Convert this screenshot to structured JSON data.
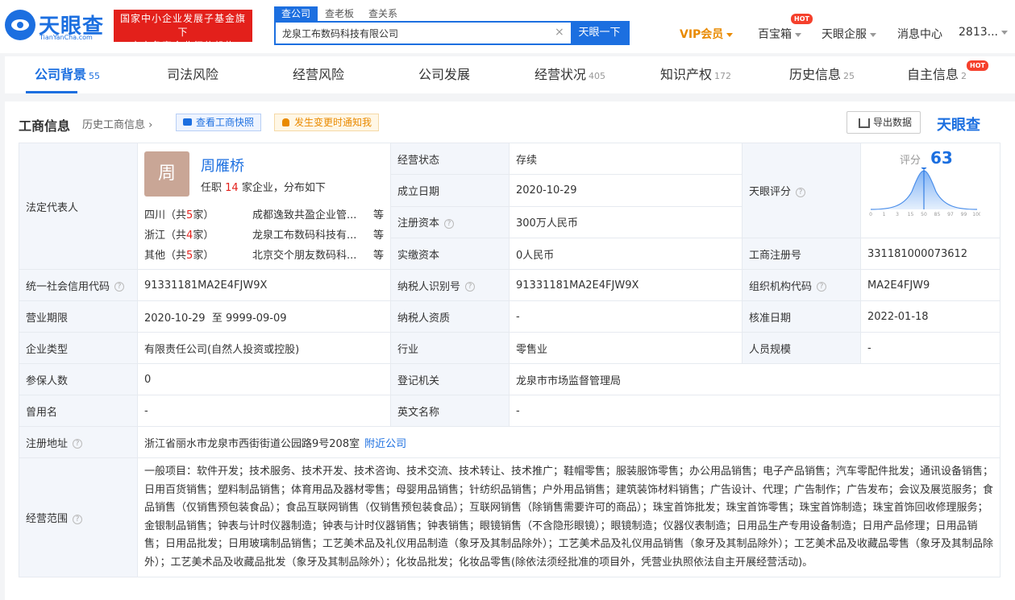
{
  "header": {
    "logo_text": "天眼查",
    "logo_sub": "TianYanCha.com",
    "banner_line1": "国家中小企业发展子基金旗下",
    "banner_line2": "官方备案企业征信机构",
    "search_tabs": [
      "查公司",
      "查老板",
      "查关系"
    ],
    "search_value": "龙泉工布数码科技有限公司",
    "clear_icon": "×",
    "search_button": "天眼一下",
    "vip": "VIP会员",
    "baibao": "百宝箱",
    "hot": "HOT",
    "qifu": "天眼企服",
    "messages": "消息中心",
    "user": "2813..."
  },
  "nav": {
    "items": [
      {
        "label": "公司背景",
        "count": "55"
      },
      {
        "label": "司法风险",
        "count": ""
      },
      {
        "label": "经营风险",
        "count": ""
      },
      {
        "label": "公司发展",
        "count": ""
      },
      {
        "label": "经营状况",
        "count": "405"
      },
      {
        "label": "知识产权",
        "count": "172"
      },
      {
        "label": "历史信息",
        "count": "25"
      },
      {
        "label": "自主信息",
        "count": "2"
      }
    ],
    "hot": "HOT"
  },
  "panel": {
    "title": "工商信息",
    "history": "历史工商信息",
    "snapshot": "查看工商快照",
    "notify": "发生变更时通知我",
    "export": "导出数据",
    "brand": "天眼查"
  },
  "legal": {
    "label": "法定代表人",
    "avatar": "周",
    "name": "周雁桥",
    "sub_prefix": "任职",
    "sub_count": "14",
    "sub_suffix": "家企业，分布如下",
    "provinces": [
      {
        "name": "四川",
        "pre": "（共",
        "num": "5",
        "post": "家）",
        "company": "成都逸致共盈企业管...",
        "etc": "等"
      },
      {
        "name": "浙江",
        "pre": "（共",
        "num": "4",
        "post": "家）",
        "company": "龙泉工布数码科技有...",
        "etc": "等"
      },
      {
        "name": "其他",
        "pre": "（共",
        "num": "5",
        "post": "家）",
        "company": "北京交个朋友数码科...",
        "etc": "等"
      }
    ]
  },
  "fields": {
    "status_k": "经营状态",
    "status_v": "存续",
    "found_k": "成立日期",
    "found_v": "2020-10-29",
    "regcap_k": "注册资本",
    "regcap_v": "300万人民币",
    "paidcap_k": "实缴资本",
    "paidcap_v": "0人民币",
    "score_k": "天眼评分",
    "score_label": "评分",
    "score_value": "63",
    "score_ticks": [
      "0",
      "1",
      "3",
      "15",
      "50",
      "85",
      "97",
      "99",
      "100"
    ],
    "regno_k": "工商注册号",
    "regno_v": "331181000073612",
    "credit_k": "统一社会信用代码",
    "credit_v": "91331181MA2E4FJW9X",
    "taxid_k": "纳税人识别号",
    "taxid_v": "91331181MA2E4FJW9X",
    "org_k": "组织机构代码",
    "org_v": "MA2E4FJW9",
    "term_k": "营业期限",
    "term_v": "2020-10-29  至 9999-09-09",
    "taxq_k": "纳税人资质",
    "taxq_v": "-",
    "approve_k": "核准日期",
    "approve_v": "2022-01-18",
    "type_k": "企业类型",
    "type_v": "有限责任公司(自然人投资或控股)",
    "industry_k": "行业",
    "industry_v": "零售业",
    "staff_k": "人员规模",
    "staff_v": "-",
    "insured_k": "参保人数",
    "insured_v": "0",
    "authority_k": "登记机关",
    "authority_v": "龙泉市市场监督管理局",
    "former_k": "曾用名",
    "former_v": "-",
    "english_k": "英文名称",
    "english_v": "-",
    "addr_k": "注册地址",
    "addr_v": "浙江省丽水市龙泉市西街街道公园路9号208室",
    "addr_link": "附近公司",
    "scope_k": "经营范围",
    "scope_v": "一般项目：软件开发；技术服务、技术开发、技术咨询、技术交流、技术转让、技术推广；鞋帽零售；服装服饰零售；办公用品销售；电子产品销售；汽车零配件批发；通讯设备销售；日用百货销售；塑料制品销售；体育用品及器材零售；母婴用品销售；针纺织品销售；户外用品销售；建筑装饰材料销售；广告设计、代理；广告制作；广告发布；会议及展览服务；食品销售（仅销售预包装食品）；食品互联网销售（仅销售预包装食品）；互联网销售（除销售需要许可的商品）；珠宝首饰批发；珠宝首饰零售；珠宝首饰制造；珠宝首饰回收修理服务；金银制品销售；钟表与计时仪器制造；钟表与计时仪器销售；钟表销售；眼镜销售（不含隐形眼镜）；眼镜制造；仪器仪表制造；日用品生产专用设备制造；日用产品修理；日用品销售；日用品批发；日用玻璃制品销售；工艺美术品及礼仪用品制造（象牙及其制品除外）；工艺美术品及礼仪用品销售（象牙及其制品除外）；工艺美术品及收藏品零售（象牙及其制品除外）；工艺美术品及收藏品批发（象牙及其制品除外）；化妆品批发；化妆品零售(除依法须经批准的项目外，凭营业执照依法自主开展经营活动)。"
  },
  "question_icon": "?"
}
